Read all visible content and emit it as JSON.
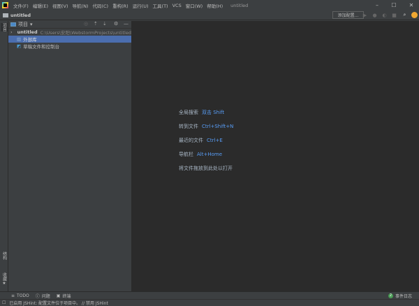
{
  "window": {
    "title": "untitled",
    "menu": [
      "文件(F)",
      "编辑(E)",
      "视图(V)",
      "导航(N)",
      "代码(C)",
      "重构(R)",
      "运行(U)",
      "工具(T)",
      "VCS",
      "窗口(W)",
      "帮助(H)"
    ]
  },
  "navbar": {
    "project": "untitled",
    "add_config": "添加配置..."
  },
  "left_tabs": {
    "project": "项目",
    "structure": "结构",
    "favorites": "收藏"
  },
  "project_panel": {
    "title": "项目",
    "tree": [
      {
        "name": "untitled",
        "path": "C:\\Users\\安阳\\WebstormProjects\\untitled"
      },
      {
        "name": "外部库"
      },
      {
        "name": "草稿文件和控制台"
      }
    ]
  },
  "editor_hints": [
    {
      "label": "全局搜索",
      "key": "双击 Shift"
    },
    {
      "label": "转到文件",
      "key": "Ctrl+Shift+N"
    },
    {
      "label": "最近的文件",
      "key": "Ctrl+E"
    },
    {
      "label": "导航栏",
      "key": "Alt+Home"
    },
    {
      "label": "将文件拖放到此处以打开",
      "key": ""
    }
  ],
  "bottom_tabs": [
    "TODO",
    "问题",
    "终端"
  ],
  "event_log": {
    "label": "事件日志",
    "count": "2"
  },
  "status": "已启用 JSHint: 配置文件位于项目中。 // 禁用 JSHint",
  "colors": {
    "accent": "#4b6eaf",
    "link": "#589df6",
    "bg": "#3c3f41",
    "editor": "#2b2b2b"
  }
}
